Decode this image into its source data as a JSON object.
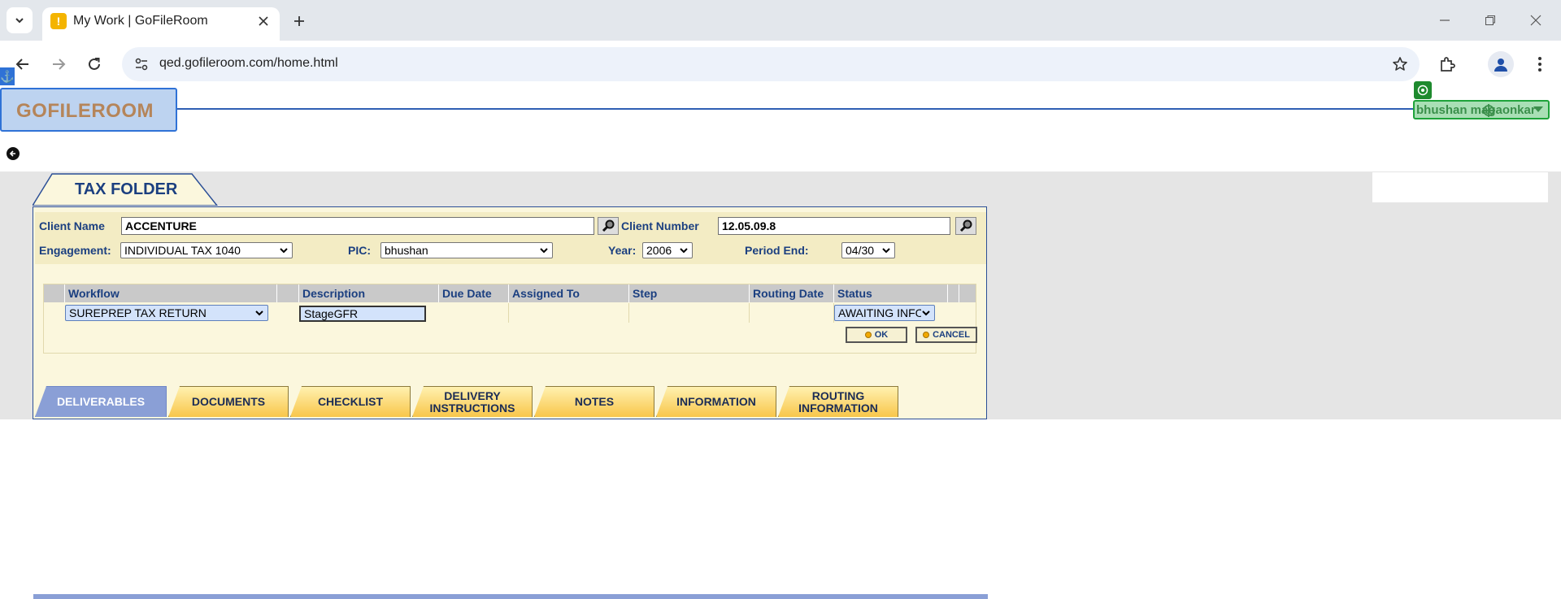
{
  "browser": {
    "tab_title": "My Work | GoFileRoom",
    "url": "qed.gofileroom.com/home.html"
  },
  "header": {
    "logo": "GOFILEROOM",
    "user_name": "bhushan magaonkar"
  },
  "tax_folder": {
    "title": "TAX FOLDER",
    "client_name_label": "Client Name",
    "client_name": "ACCENTURE",
    "client_number_label": "Client Number",
    "client_number": "12.05.09.8",
    "engagement_label": "Engagement:",
    "engagement": "INDIVIDUAL TAX 1040",
    "pic_label": "PIC:",
    "pic": "bhushan",
    "year_label": "Year:",
    "year": "2006",
    "period_end_label": "Period End:",
    "period_end": "04/30"
  },
  "workflow_table": {
    "columns": [
      "Workflow",
      "Description",
      "Due Date",
      "Assigned To",
      "Step",
      "Routing Date",
      "Status"
    ],
    "row": {
      "workflow": "SUREPREP TAX RETURN",
      "description": "StageGFR",
      "status": "AWAITING INFO"
    },
    "ok_label": "OK",
    "cancel_label": "CANCEL"
  },
  "tabs": [
    {
      "label": "DELIVERABLES",
      "active": true
    },
    {
      "label": "DOCUMENTS"
    },
    {
      "label": "CHECKLIST"
    },
    {
      "label": "DELIVERY INSTRUCTIONS"
    },
    {
      "label": "NOTES"
    },
    {
      "label": "INFORMATION"
    },
    {
      "label": "ROUTING INFORMATION"
    }
  ],
  "colors": {
    "brand_blue": "#1b3f80",
    "panel_bg": "#fbf7dd",
    "tab_gold": "#f8c64a",
    "active_tab": "#8a9fd6",
    "user_green": "#1ea33a"
  }
}
